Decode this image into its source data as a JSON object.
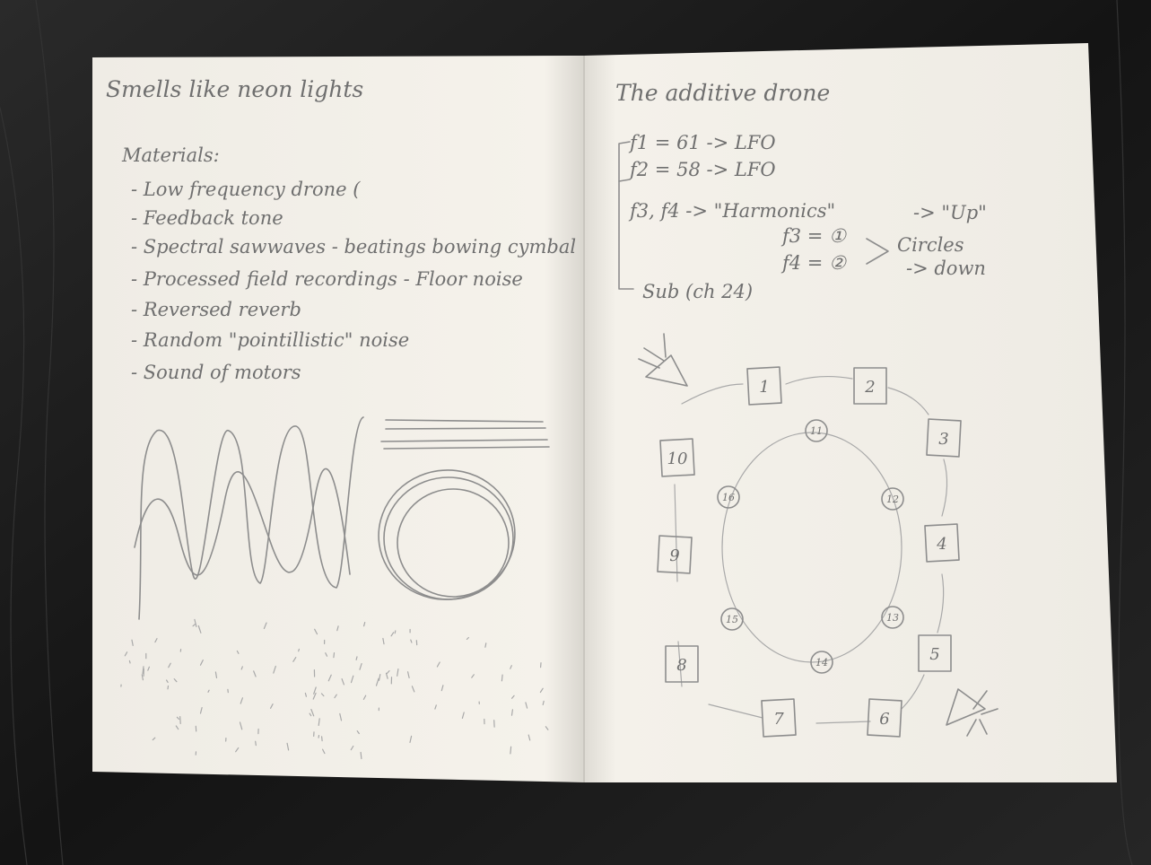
{
  "left_page": {
    "title": "Smells like neon lights",
    "materials_heading": "Materials:",
    "materials": [
      "- Low frequency drone (",
      "- Feedback tone",
      "- Spectral sawwaves - beatings bowing cymbal",
      "- Processed field recordings - Floor noise",
      "- Reversed reverb",
      "- Random \"pointillistic\" noise",
      "- Sound of motors"
    ]
  },
  "right_page": {
    "title": "The additive drone",
    "f1": "f1 = 61 -> LFO",
    "f2": "f2 = 58 -> LFO",
    "f34": "f3, f4 -> \"Harmonics\"",
    "up": "-> \"Up\"",
    "f3": "f3 = ①",
    "f4": "f4 = ②",
    "circles": "Circles",
    "down": "-> down",
    "sub": "Sub (ch 24)",
    "outer_speakers": [
      "1",
      "2",
      "3",
      "4",
      "5",
      "6",
      "7",
      "8",
      "9",
      "10"
    ],
    "inner_speakers": [
      "11",
      "12",
      "13",
      "14",
      "15",
      "16"
    ]
  },
  "colors": {
    "table": "#1b1b1b",
    "paper": "#f4f1ea",
    "pencil": "#6f6f6f"
  }
}
